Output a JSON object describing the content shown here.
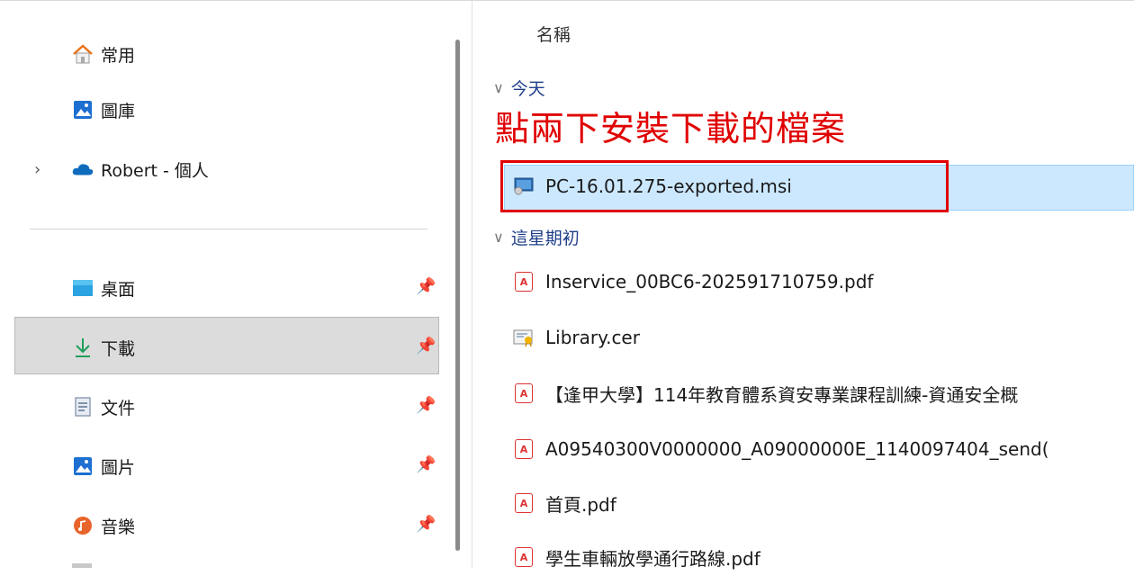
{
  "nav": {
    "home": "常用",
    "gallery": "圖庫",
    "onedrive": "Robert - 個人",
    "desktop": "桌面",
    "downloads": "下載",
    "documents": "文件",
    "pictures": "圖片",
    "music": "音樂"
  },
  "content": {
    "column_name": "名稱",
    "group_today": "今天",
    "group_week": "這星期初",
    "annotation": "點兩下安裝下載的檔案",
    "files_today": [
      {
        "name": "PC-16.01.275-exported.msi",
        "icon": "installer-icon"
      }
    ],
    "files_week": [
      {
        "name": "Inservice_00BC6-202591710759.pdf",
        "icon": "pdf-icon"
      },
      {
        "name": "Library.cer",
        "icon": "certificate-icon"
      },
      {
        "name": "【逢甲大學】114年教育體系資安專業課程訓練-資通安全概",
        "icon": "pdf-icon"
      },
      {
        "name": "A09540300V0000000_A09000000E_1140097404_send(",
        "icon": "pdf-icon"
      },
      {
        "name": "首頁.pdf",
        "icon": "pdf-icon"
      },
      {
        "name": "學生車輛放學通行路線.pdf",
        "icon": "pdf-icon"
      }
    ]
  },
  "colors": {
    "selection": "#cce8ff",
    "annotation": "#e00000",
    "group_text": "#1f3f8a"
  }
}
